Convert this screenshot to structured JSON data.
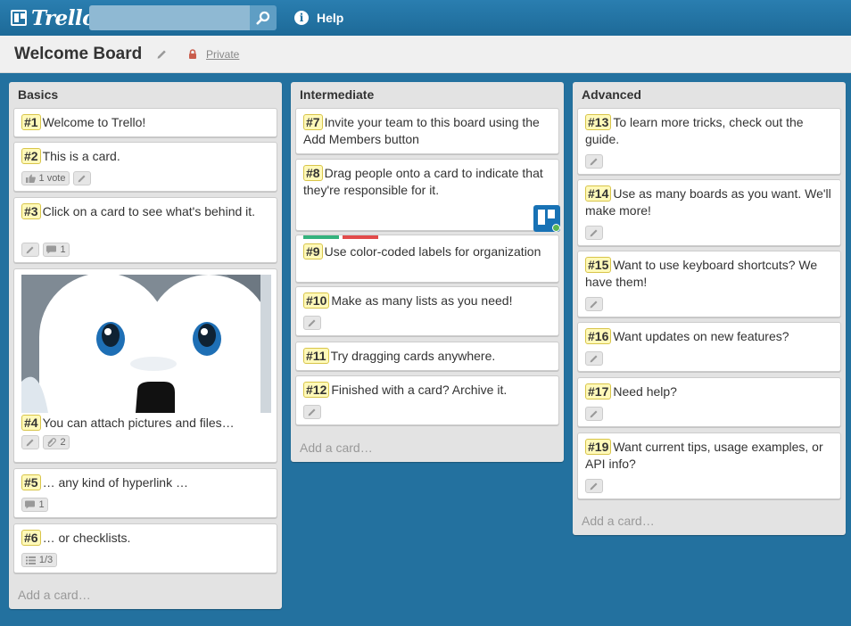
{
  "header": {
    "logo_text": "Trello",
    "search_value": "",
    "help_label": "Help"
  },
  "board": {
    "title": "Welcome Board",
    "visibility": "Private"
  },
  "lists": [
    {
      "title": "Basics",
      "add_card": "Add a card…",
      "cards": [
        {
          "num": "#1",
          "text": "Welcome to Trello!"
        },
        {
          "num": "#2",
          "text": "This is a card.",
          "badges": {
            "votes": "1 vote"
          }
        },
        {
          "num": "#3",
          "text": "Click on a card to see what's behind it.",
          "badges": {
            "comments": "1"
          }
        },
        {
          "num": "#4",
          "text": "You can attach pictures and files…",
          "badges": {
            "attachments": "2"
          }
        },
        {
          "num": "#5",
          "text": "… any kind of hyperlink …",
          "badges": {
            "comments": "1"
          }
        },
        {
          "num": "#6",
          "text": "… or checklists.",
          "badges": {
            "checklist": "1/3"
          }
        }
      ]
    },
    {
      "title": "Intermediate",
      "add_card": "Add a card…",
      "cards": [
        {
          "num": "#7",
          "text": "Invite your team to this board using the Add Members button"
        },
        {
          "num": "#8",
          "text": "Drag people onto a card to indicate that they're responsible for it."
        },
        {
          "num": "#9",
          "text": "Use color-coded labels for organization",
          "labels": [
            "#34b27d",
            "#e24b4b"
          ]
        },
        {
          "num": "#10",
          "text": "Make as many lists as you need!"
        },
        {
          "num": "#11",
          "text": "Try dragging cards anywhere."
        },
        {
          "num": "#12",
          "text": "Finished with a card? Archive it."
        }
      ]
    },
    {
      "title": "Advanced",
      "add_card": "Add a card…",
      "cards": [
        {
          "num": "#13",
          "text": "To learn more tricks, check out the guide."
        },
        {
          "num": "#14",
          "text": "Use as many boards as you want. We'll make more!"
        },
        {
          "num": "#15",
          "text": "Want to use keyboard shortcuts? We have them!"
        },
        {
          "num": "#16",
          "text": "Want updates on new features?"
        },
        {
          "num": "#17",
          "text": "Need help?"
        },
        {
          "num": "#19",
          "text": "Want current tips, usage examples, or API info?"
        }
      ]
    }
  ],
  "colors": {
    "board_background": "#23719f",
    "header_background": "#1f6f9f",
    "card_number_background": "#fff9b9",
    "avatar_background": "#1872b5"
  }
}
